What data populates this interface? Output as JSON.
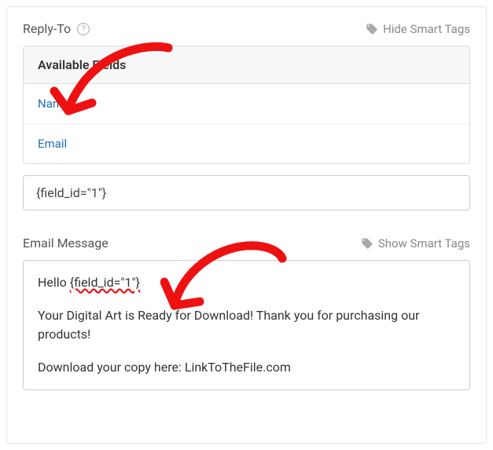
{
  "replyTo": {
    "label": "Reply-To",
    "smartTagsLabel": "Hide Smart Tags",
    "fieldsHeader": "Available Fields",
    "fields": [
      "Name",
      "Email"
    ],
    "inputValue": "{field_id=\"1\"}"
  },
  "emailMessage": {
    "label": "Email Message",
    "smartTagsLabel": "Show Smart Tags",
    "body": {
      "greeting": "Hello ",
      "tag": "{field_id=\"1\"}",
      "line2": "Your Digital Art is Ready for Download! Thank you for purchasing our products!",
      "line3": "Download your copy here: LinkToTheFile.com"
    }
  }
}
